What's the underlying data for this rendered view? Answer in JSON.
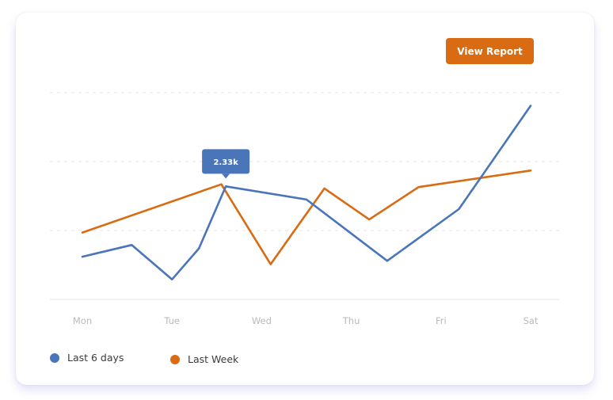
{
  "button": {
    "label": "View Report"
  },
  "tooltip": {
    "text": "2.33k"
  },
  "colors": {
    "blue": "#4A76B9",
    "orange": "#D96B12",
    "grid": "#e3e3e3",
    "tick": "#b9b9b9"
  },
  "chart_data": {
    "type": "line",
    "categories": [
      "Mon",
      "Tue",
      "Wed",
      "Thu",
      "Fri",
      "Sat"
    ],
    "ylim": [
      0,
      4
    ],
    "grid": true,
    "legend_position": "bottom-left",
    "series": [
      {
        "name": "Last 6 days",
        "color": "#4A76B9",
        "x": [
          0,
          0.55,
          1.0,
          1.3,
          1.6,
          2.5,
          3.4,
          4.2,
          5.0
        ],
        "values": [
          0.62,
          0.79,
          0.29,
          0.74,
          1.64,
          1.45,
          0.56,
          1.31,
          2.81
        ]
      },
      {
        "name": "Last Week",
        "color": "#D96B12",
        "x": [
          0,
          1.55,
          2.1,
          2.7,
          3.2,
          3.75,
          5.0
        ],
        "values": [
          0.97,
          1.67,
          0.51,
          1.61,
          1.16,
          1.63,
          1.87
        ]
      }
    ],
    "annotation": {
      "series": "Last 6 days",
      "point_index": 4,
      "label": "2.33k"
    }
  }
}
